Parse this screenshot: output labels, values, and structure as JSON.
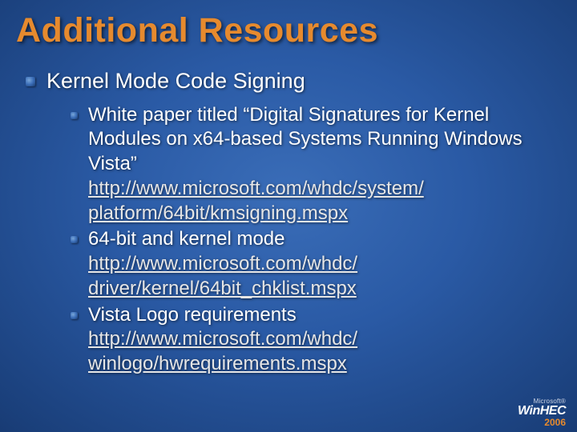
{
  "title": "Additional Resources",
  "lvl1": {
    "text": "Kernel Mode Code Signing"
  },
  "lvl2": [
    {
      "text": "White paper titled “Digital Signatures for Kernel Modules on x64-based Systems Running Windows Vista”",
      "link_lines": [
        "http://www.microsoft.com/whdc/system/",
        "platform/64bit/kmsigning.mspx"
      ]
    },
    {
      "text": "64-bit and kernel mode",
      "link_lines": [
        "http://www.microsoft.com/whdc/",
        "driver/kernel/64bit_chklist.mspx"
      ]
    },
    {
      "text": "Vista Logo requirements",
      "link_lines": [
        "http://www.microsoft.com/whdc/",
        "winlogo/hwrequirements.mspx"
      ]
    }
  ],
  "footer": {
    "brand_small": "Microsoft®",
    "brand_main": "WinHEC",
    "year": "2006"
  }
}
